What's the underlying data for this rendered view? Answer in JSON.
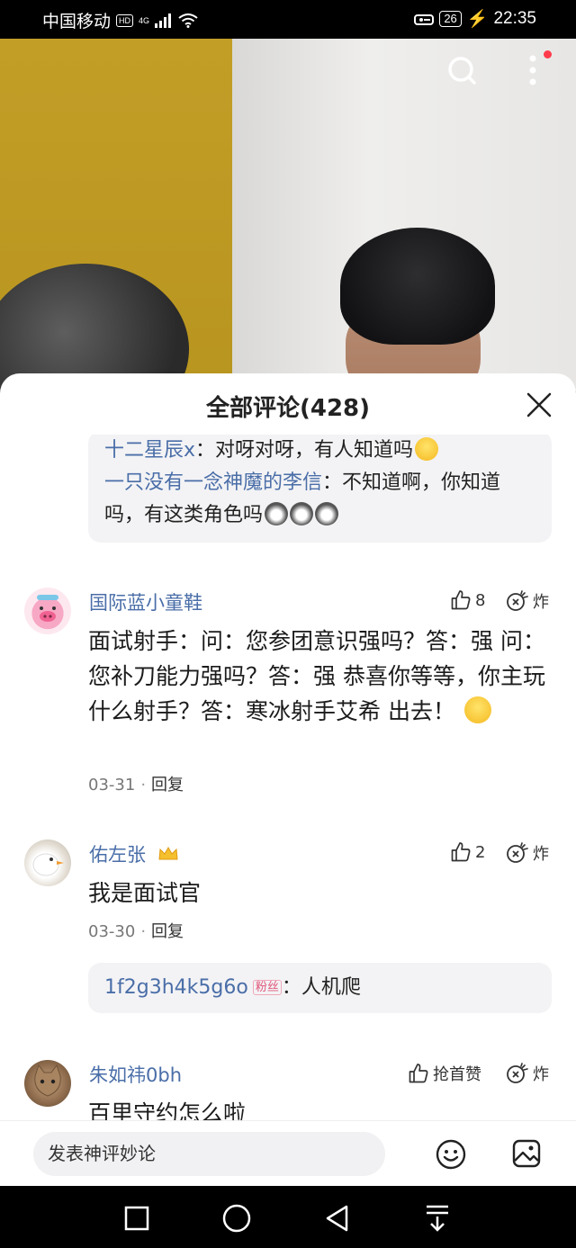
{
  "status_bar": {
    "carrier": "中国移动",
    "hd": "HD",
    "network": "4G",
    "battery": "26",
    "time": "22:35"
  },
  "sheet": {
    "title": "全部评论(428)"
  },
  "replies_top": [
    {
      "name": "十二星辰x",
      "text": "：对呀对呀，有人知道吗"
    },
    {
      "name": "一只没有一念神魔的李信",
      "text": "：不知道啊，你知道吗，有这类角色吗"
    }
  ],
  "comments": [
    {
      "user": "国际蓝小童鞋",
      "text": "面试射手：问：您参团意识强吗？答：强 问：您补刀能力强吗？答：强 恭喜你等等，你主玩什么射手？答：寒冰射手艾希 出去！",
      "date": "03-31",
      "reply_label": "回复",
      "likes": "8",
      "bomb_label": "炸"
    },
    {
      "user": "佑左张",
      "text": "我是面试官",
      "date": "03-30",
      "reply_label": "回复",
      "likes": "2",
      "bomb_label": "炸",
      "sub_reply": {
        "name": "1f2g3h4k5g6o",
        "badge": "粉丝",
        "text": "：人机爬"
      }
    },
    {
      "user": "朱如祎0bh",
      "text": "百里守约怎么啦",
      "likes_label": "抢首赞",
      "bomb_label": "炸"
    }
  ],
  "input": {
    "placeholder": "发表神评妙论"
  },
  "colors": {
    "link_blue": "#4a6ea8",
    "reply_bg": "#f3f3f5"
  }
}
